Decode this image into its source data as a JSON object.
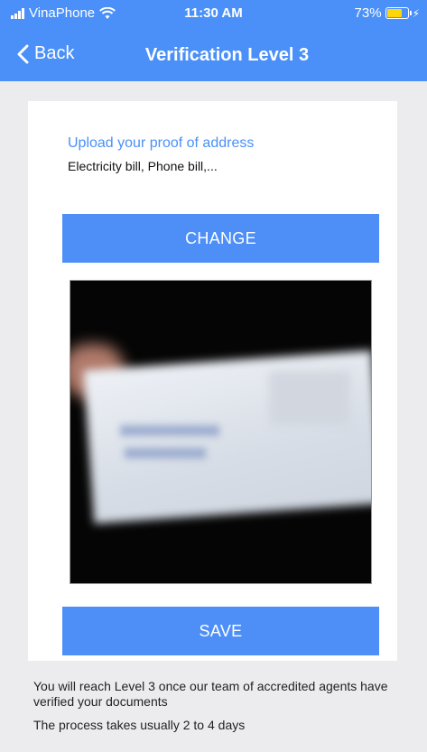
{
  "status_bar": {
    "carrier": "VinaPhone",
    "time": "11:30 AM",
    "battery": "73%",
    "battery_level": 0.73
  },
  "nav": {
    "back_label": "Back",
    "title": "Verification Level 3"
  },
  "upload": {
    "title": "Upload your proof of address",
    "subtitle": "Electricity bill, Phone bill,..."
  },
  "buttons": {
    "change_label": "CHANGE",
    "save_label": "SAVE"
  },
  "info": {
    "line1": "You will reach Level 3 once our team of accredited agents have verified your documents",
    "line2": "The process takes usually 2 to 4 days"
  },
  "colors": {
    "accent": "#4a90f8",
    "battery": "#ffd60a",
    "background": "#ececef"
  },
  "icons": [
    "signal-icon",
    "wifi-icon",
    "battery-icon",
    "charging-icon",
    "chevron-left-icon"
  ]
}
